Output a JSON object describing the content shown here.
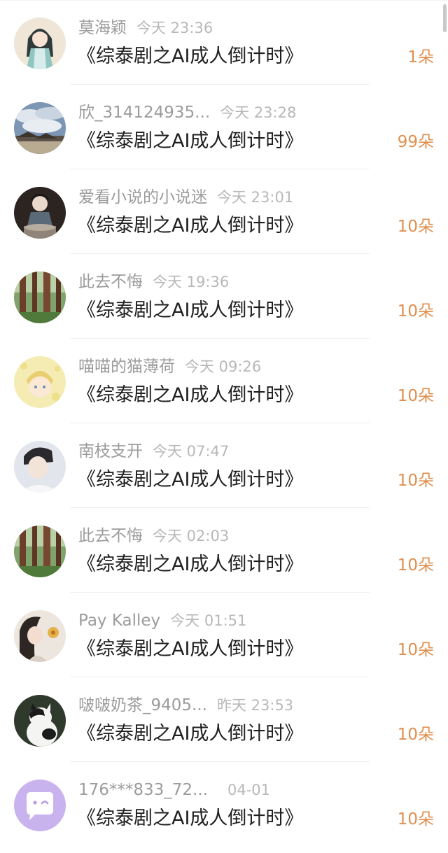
{
  "rows": [
    {
      "name": "莫海颖",
      "time": "今天 23:36",
      "book": "《综泰剧之AI成人倒计时》",
      "gift": "1朵",
      "avatar_icon": "anime-girl-avatar-icon"
    },
    {
      "name": "欣_314124935...",
      "time": "今天 23:28",
      "book": "《综泰剧之AI成人倒计时》",
      "gift": "99朵",
      "avatar_icon": "sky-temple-avatar-icon"
    },
    {
      "name": "爱看小说的小说迷",
      "time": "今天 23:01",
      "book": "《综泰剧之AI成人倒计时》",
      "gift": "10朵",
      "avatar_icon": "doll-figure-avatar-icon"
    },
    {
      "name": "此去不悔",
      "time": "今天 19:36",
      "book": "《综泰剧之AI成人倒计时》",
      "gift": "10朵",
      "avatar_icon": "forest-avatar-icon"
    },
    {
      "name": "喵喵的猫薄荷",
      "time": "今天 09:26",
      "book": "《综泰剧之AI成人倒计时》",
      "gift": "10朵",
      "avatar_icon": "cartoon-face-avatar-icon"
    },
    {
      "name": "南枝支开",
      "time": "今天 07:47",
      "book": "《综泰剧之AI成人倒计时》",
      "gift": "10朵",
      "avatar_icon": "portrait-avatar-icon"
    },
    {
      "name": "此去不悔",
      "time": "今天 02:03",
      "book": "《综泰剧之AI成人倒计时》",
      "gift": "10朵",
      "avatar_icon": "forest-avatar-icon"
    },
    {
      "name": "Pay Kalley",
      "time": "今天 01:51",
      "book": "《综泰剧之AI成人倒计时》",
      "gift": "10朵",
      "avatar_icon": "woman-flower-avatar-icon"
    },
    {
      "name": "啵啵奶茶_9405...",
      "time": "昨天 23:53",
      "book": "《综泰剧之AI成人倒计时》",
      "gift": "10朵",
      "avatar_icon": "cat-avatar-icon"
    },
    {
      "name": "176***833_72...",
      "time": "04-01",
      "book": "《综泰剧之AI成人倒计时》",
      "gift": "10朵",
      "avatar_icon": "default-chat-avatar-icon"
    }
  ],
  "colors": {
    "name": "#9c9c9c",
    "time": "#b8b8b8",
    "book": "#1f1f1f",
    "gift": "#e08f4f"
  }
}
